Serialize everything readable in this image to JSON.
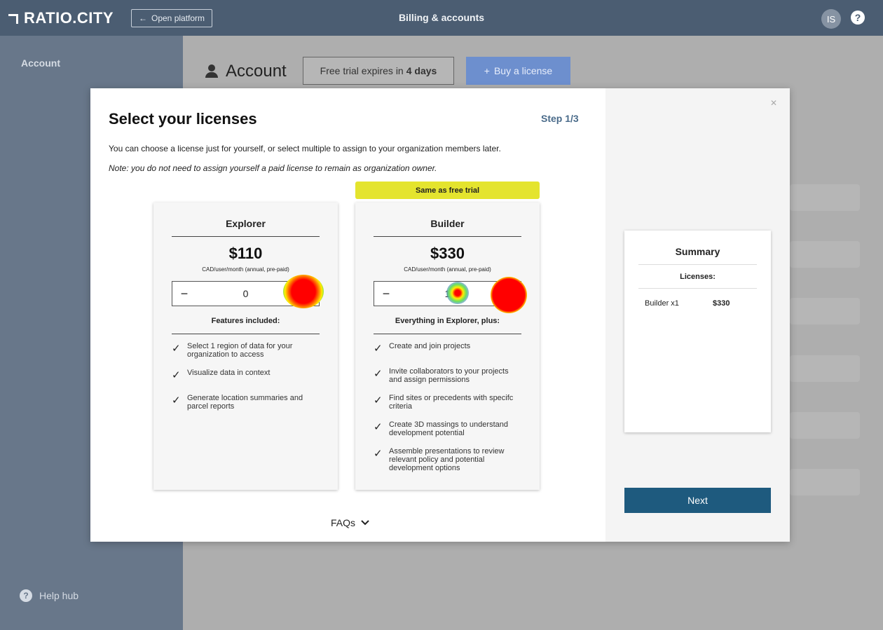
{
  "topbar": {
    "logo": "RATIO.CITY",
    "open_platform": "Open platform",
    "title": "Billing & accounts",
    "avatar_initials": "IS",
    "help": "?"
  },
  "sidebar": {
    "account": "Account",
    "help_hub": "Help hub"
  },
  "background": {
    "account_title": "Account",
    "trial_prefix": "Free trial expires in",
    "trial_days": "4 days",
    "buy_label": "Buy a license"
  },
  "modal": {
    "title": "Select your licenses",
    "step": "Step 1/3",
    "intro": "You can choose a license just for yourself, or select multiple to assign to your organization members later.",
    "note": "Note: you do not need to assign yourself a paid license to remain as organization owner.",
    "badge": "Same as free trial",
    "faqs": "FAQs",
    "cards": [
      {
        "name": "Explorer",
        "price": "$110",
        "unit": "CAD/user/month (annual, pre-paid)",
        "quantity": "0",
        "features_title": "Features included:",
        "features": [
          "Select 1 region of data for your organization to access",
          "Visualize data in context",
          "Generate location summaries and parcel reports"
        ]
      },
      {
        "name": "Builder",
        "price": "$330",
        "unit": "CAD/user/month (annual, pre-paid)",
        "quantity": "1",
        "features_title": "Everything in Explorer, plus:",
        "features": [
          "Create and join projects",
          "Invite collaborators to your projects and assign permissions",
          "Find sites or precedents with specifc criteria",
          "Create 3D massings to understand development potential",
          "Assemble presentations to review relevant policy and potential development options"
        ]
      }
    ],
    "summary": {
      "title": "Summary",
      "licenses_label": "Licenses:",
      "item": "Builder x1",
      "item_price": "$330"
    },
    "next": "Next"
  },
  "colors": {
    "topbar": "#4b5d72",
    "sidebar": "#68778a",
    "accent": "#1e5a7e",
    "badge": "#e4e42e",
    "buy_button": "#6d8fce"
  }
}
